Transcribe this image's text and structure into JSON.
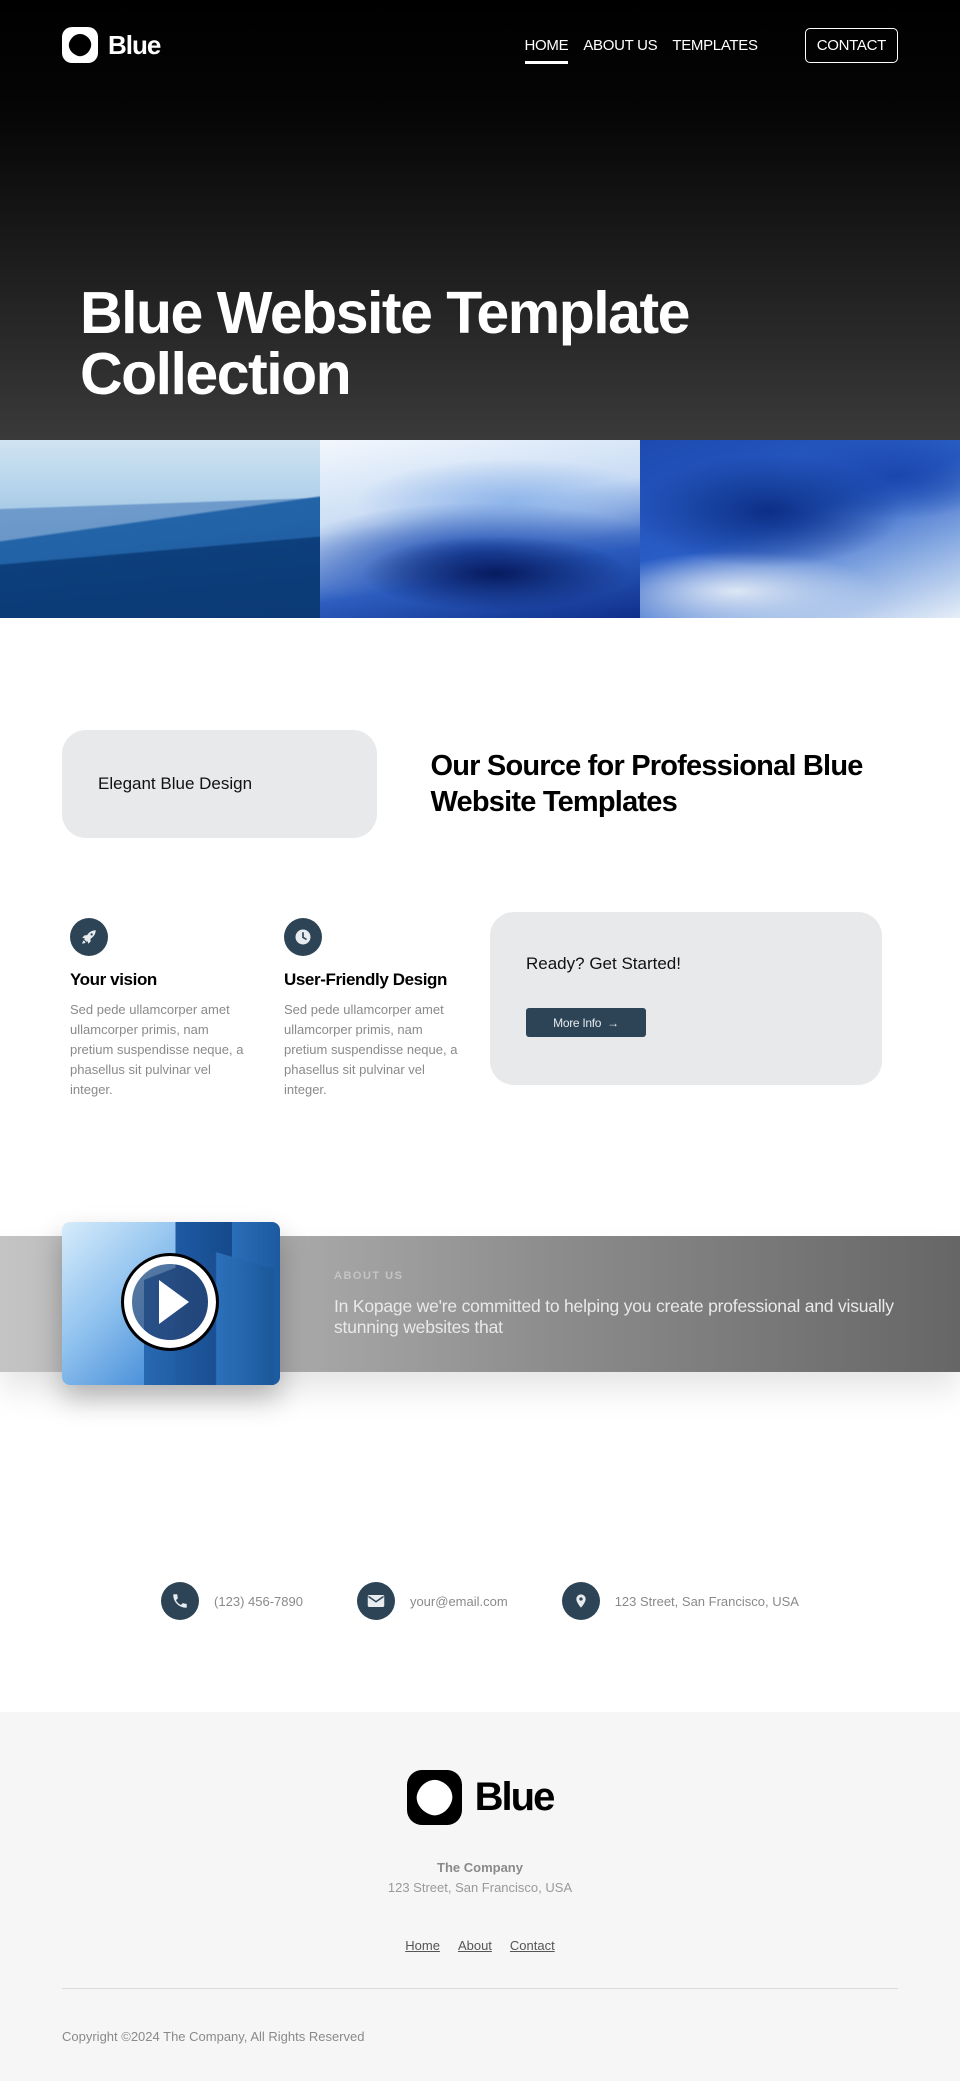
{
  "header": {
    "brand": "Blue",
    "nav": [
      {
        "label": "HOME",
        "active": true
      },
      {
        "label": "ABOUT US",
        "active": false
      },
      {
        "label": "TEMPLATES",
        "active": false
      }
    ],
    "contact_button": "CONTACT"
  },
  "hero": {
    "title_line1": "Blue Website Template",
    "title_line2": "Collection"
  },
  "gallery": {
    "images": [
      {
        "icon": "mountains-image"
      },
      {
        "icon": "blue-silk-image"
      },
      {
        "icon": "blue-smoke-image"
      }
    ]
  },
  "intro": {
    "card_label": "Elegant Blue Design",
    "heading": "Our Source for Professional Blue Website Templates"
  },
  "features": [
    {
      "icon": "rocket-icon",
      "title": "Your vision",
      "body": "Sed pede ullamcorper amet ullamcorper primis, nam pretium suspendisse neque, a phasellus sit pulvinar vel integer."
    },
    {
      "icon": "clock-icon",
      "title": "User-Friendly Design",
      "body": "Sed pede ullamcorper amet ullamcorper primis, nam pretium suspendisse neque, a phasellus sit pulvinar vel integer."
    }
  ],
  "cta": {
    "title": "Ready? Get Started!",
    "button": "More Info",
    "button_icon": "→"
  },
  "about": {
    "label": "ABOUT US",
    "body": "In Kopage we're committed to helping you create professional and visually stunning websites that"
  },
  "contacts": [
    {
      "icon": "phone-icon",
      "text": "(123) 456-7890"
    },
    {
      "icon": "envelope-icon",
      "text": "your@email.com"
    },
    {
      "icon": "map-pin-icon",
      "text": "123 Street, San Francisco, USA"
    }
  ],
  "footer": {
    "brand": "Blue",
    "company": "The Company",
    "address": "123 Street, San Francisco, USA",
    "links": [
      "Home",
      "About",
      "Contact"
    ],
    "copyright": "Copyright ©2024 The Company, All Rights Reserved"
  },
  "colors": {
    "accent": "#2c4456",
    "card_bg": "#e8e9eb",
    "footer_bg": "#f6f6f6",
    "muted_text": "#8a8a8a"
  }
}
